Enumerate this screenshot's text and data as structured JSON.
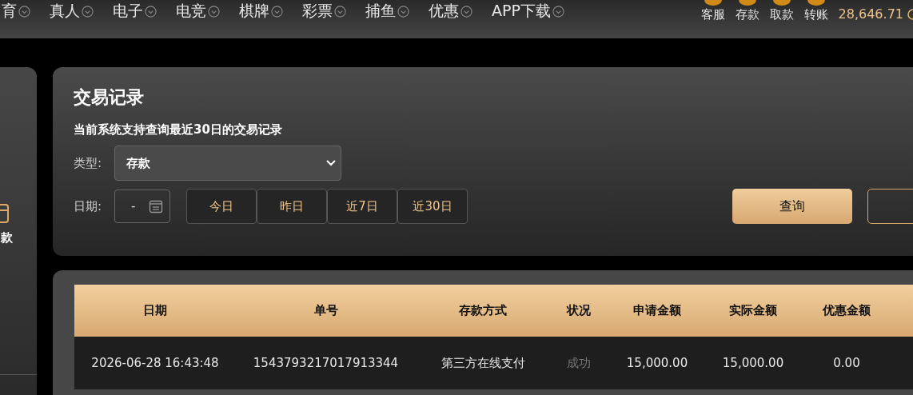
{
  "nav": {
    "items": [
      {
        "label": "育"
      },
      {
        "label": "真人"
      },
      {
        "label": "电子"
      },
      {
        "label": "电竞"
      },
      {
        "label": "棋牌"
      },
      {
        "label": "彩票"
      },
      {
        "label": "捕鱼"
      },
      {
        "label": "优惠"
      },
      {
        "label": "APP下载"
      }
    ],
    "actions": [
      {
        "label": "客服"
      },
      {
        "label": "存款"
      },
      {
        "label": "取款"
      },
      {
        "label": "转账"
      }
    ],
    "balance": "28,646.71"
  },
  "sidebar": {
    "items": [
      {
        "label": "款"
      }
    ]
  },
  "panel": {
    "title": "交易记录",
    "subtitle": "当前系统支持查询最近30日的交易记录",
    "type_label": "类型:",
    "type_value": "存款",
    "date_label": "日期:",
    "date_value": "-",
    "quick_ranges": [
      {
        "label": "今日",
        "selected": false
      },
      {
        "label": "昨日",
        "selected": false
      },
      {
        "label": "近7日",
        "selected": false
      },
      {
        "label": "近30日",
        "selected": false
      }
    ],
    "query_button": "查询"
  },
  "table": {
    "columns": [
      "日期",
      "单号",
      "存款方式",
      "状况",
      "申请金额",
      "实际金额",
      "优惠金额"
    ],
    "rows": [
      {
        "cells": [
          {
            "text": "2026-06-28 16:43:48",
            "kind": "text"
          },
          {
            "text": "1543793217017913344",
            "kind": "text"
          },
          {
            "text": "第三方在线支付",
            "kind": "text"
          },
          {
            "text": "成功",
            "kind": "status"
          },
          {
            "text": "15,000.00",
            "kind": "text"
          },
          {
            "text": "15,000.00",
            "kind": "text"
          },
          {
            "text": "0.00",
            "kind": "text"
          }
        ]
      }
    ]
  }
}
